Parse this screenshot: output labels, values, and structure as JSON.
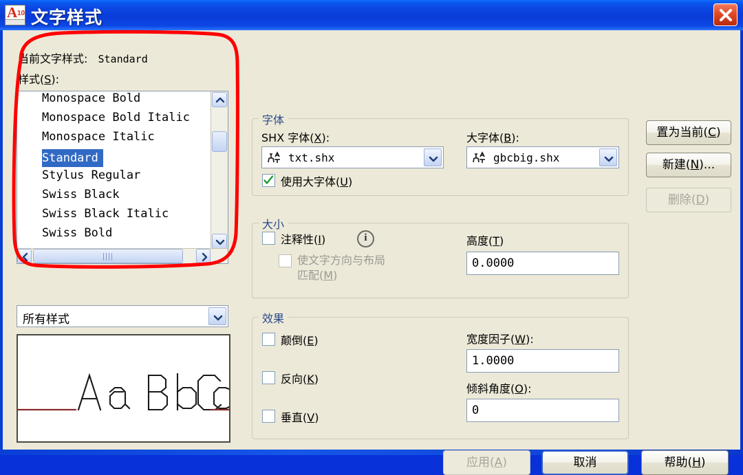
{
  "window": {
    "title": "文字样式",
    "app_icon": {
      "letter": "A",
      "version": "10"
    },
    "close_label": "×"
  },
  "left_panel": {
    "current_style_label": "当前文字样式:",
    "current_style_value": "Standard",
    "styles_label_pre": "样式",
    "styles_label_key": "S",
    "styles_label_post": "):",
    "style_list": [
      "Monospace Bold",
      "Monospace Bold Italic",
      "Monospace Italic",
      "Standard",
      "Stylus Regular",
      "Swiss Black",
      "Swiss Black Italic",
      "Swiss Bold"
    ],
    "selected_style": "Standard",
    "filter_value": "所有样式",
    "preview_text": "AaBbCc"
  },
  "font_group": {
    "legend": "字体",
    "shx_label_pre": "SHX 字体",
    "shx_label_key": "X",
    "shx_label_post": "):",
    "shx_value": "txt.shx",
    "bigfont_label_pre": "大字体",
    "bigfont_label_key": "B",
    "bigfont_label_post": "):",
    "bigfont_value": "gbcbig.shx",
    "use_bigfont_pre": "使用大字体",
    "use_bigfont_key": "U",
    "use_bigfont_post": ")",
    "use_bigfont_checked": true
  },
  "size_group": {
    "legend": "大小",
    "annotative_pre": "注释性",
    "annotative_key": "I",
    "annotative_post": ")",
    "annotative_checked": false,
    "info_glyph": "i",
    "match_orientation_line1": "使文字方向与布局",
    "match_orientation_line2_pre": "匹配",
    "match_orientation_key": "M",
    "match_orientation_post": ")",
    "match_orientation_checked": false,
    "height_label_pre": "高度",
    "height_label_key": "T",
    "height_label_post": ")",
    "height_value": "0.0000"
  },
  "effects_group": {
    "legend": "效果",
    "upside_down_pre": "颠倒",
    "upside_down_key": "E",
    "upside_down_post": ")",
    "upside_down_checked": false,
    "backwards_pre": "反向",
    "backwards_key": "K",
    "backwards_post": ")",
    "backwards_checked": false,
    "vertical_pre": "垂直",
    "vertical_key": "V",
    "vertical_post": ")",
    "vertical_checked": false,
    "width_factor_pre": "宽度因子",
    "width_factor_key": "W",
    "width_factor_post": "):",
    "width_factor_value": "1.0000",
    "oblique_pre": "倾斜角度",
    "oblique_key": "O",
    "oblique_post": "):",
    "oblique_value": "0"
  },
  "buttons": {
    "set_current_pre": "置为当前",
    "set_current_key": "C",
    "set_current_post": ")",
    "new_pre": "新建",
    "new_key": "N",
    "new_post": ")...",
    "delete_pre": "删除",
    "delete_key": "D",
    "delete_post": ")",
    "apply_pre": "应用",
    "apply_key": "A",
    "apply_post": ")",
    "cancel": "取消",
    "help_pre": "帮助",
    "help_key": "H",
    "help_post": ")"
  },
  "annotation": {
    "shape": "red-rounded-highlight",
    "color": "#ff0000"
  },
  "colors": {
    "dialog_background": "#ece9d8",
    "titlebar_blue": "#0b46e0",
    "selection_blue": "#316ac5",
    "group_legend_blue": "#2c4a8c",
    "annotation_red": "#ff0000"
  }
}
